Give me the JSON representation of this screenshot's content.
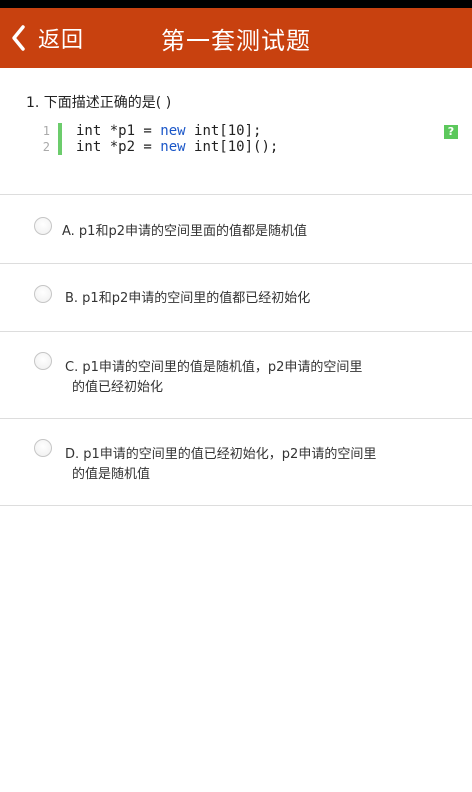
{
  "header": {
    "back_label": "返回",
    "title": "第一套测试题",
    "color": "#c8410f"
  },
  "question": {
    "text": "1. 下面描述正确的是( )",
    "code": [
      {
        "num": "1",
        "pre": "int *p1 = ",
        "kw": "new",
        "post": " int[10];"
      },
      {
        "num": "2",
        "pre": "int *p2 = ",
        "kw": "new",
        "post": " int[10]();"
      }
    ],
    "help_icon": "?"
  },
  "options": [
    {
      "line1": "A. p1和p2申请的空间里面的值都是随机值",
      "line2": ""
    },
    {
      "line1": "B. p1和p2申请的空间里的值都已经初始化",
      "line2": ""
    },
    {
      "line1": "C. p1申请的空间里的值是随机值，p2申请的空间里",
      "line2": "的值已经初始化"
    },
    {
      "line1": "D. p1申请的空间里的值已经初始化，p2申请的空间里",
      "line2": "的值是随机值"
    }
  ]
}
